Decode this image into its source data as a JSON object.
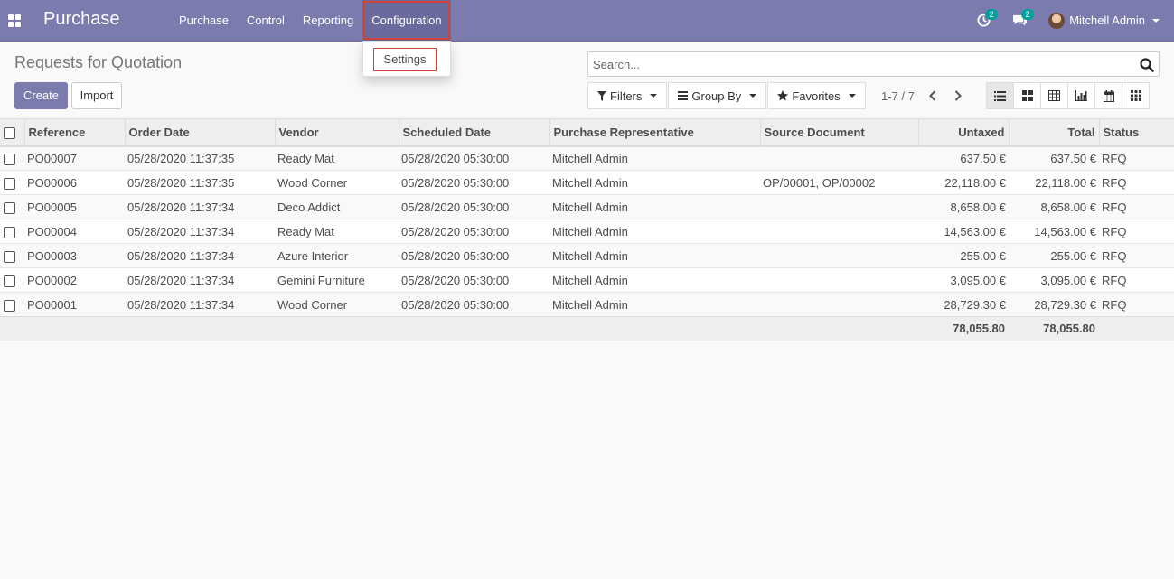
{
  "navbar": {
    "app_title": "Purchase",
    "menu": [
      "Purchase",
      "Control",
      "Reporting",
      "Configuration"
    ],
    "activities_badge": "2",
    "messages_badge": "2",
    "user_name": "Mitchell Admin"
  },
  "dropdown": {
    "settings_label": "Settings"
  },
  "control_panel": {
    "title": "Requests for Quotation",
    "create_label": "Create",
    "import_label": "Import",
    "search_placeholder": "Search...",
    "filters_label": "Filters",
    "group_by_label": "Group By",
    "favorites_label": "Favorites",
    "pager": "1-7 / 7"
  },
  "table": {
    "columns": [
      "Reference",
      "Order Date",
      "Vendor",
      "Scheduled Date",
      "Purchase Representative",
      "Source Document",
      "Untaxed",
      "Total",
      "Status"
    ],
    "rows": [
      [
        "PO00007",
        "05/28/2020 11:37:35",
        "Ready Mat",
        "05/28/2020 05:30:00",
        "Mitchell Admin",
        "",
        "637.50 €",
        "637.50 €",
        "RFQ"
      ],
      [
        "PO00006",
        "05/28/2020 11:37:35",
        "Wood Corner",
        "05/28/2020 05:30:00",
        "Mitchell Admin",
        "OP/00001, OP/00002",
        "22,118.00 €",
        "22,118.00 €",
        "RFQ"
      ],
      [
        "PO00005",
        "05/28/2020 11:37:34",
        "Deco Addict",
        "05/28/2020 05:30:00",
        "Mitchell Admin",
        "",
        "8,658.00 €",
        "8,658.00 €",
        "RFQ"
      ],
      [
        "PO00004",
        "05/28/2020 11:37:34",
        "Ready Mat",
        "05/28/2020 05:30:00",
        "Mitchell Admin",
        "",
        "14,563.00 €",
        "14,563.00 €",
        "RFQ"
      ],
      [
        "PO00003",
        "05/28/2020 11:37:34",
        "Azure Interior",
        "05/28/2020 05:30:00",
        "Mitchell Admin",
        "",
        "255.00 €",
        "255.00 €",
        "RFQ"
      ],
      [
        "PO00002",
        "05/28/2020 11:37:34",
        "Gemini Furniture",
        "05/28/2020 05:30:00",
        "Mitchell Admin",
        "",
        "3,095.00 €",
        "3,095.00 €",
        "RFQ"
      ],
      [
        "PO00001",
        "05/28/2020 11:37:34",
        "Wood Corner",
        "05/28/2020 05:30:00",
        "Mitchell Admin",
        "",
        "28,729.30 €",
        "28,729.30 €",
        "RFQ"
      ]
    ],
    "totals": {
      "untaxed": "78,055.80",
      "total": "78,055.80"
    }
  },
  "colors": {
    "brand": "#7c7bad",
    "highlight": "#d04437",
    "badge": "#00a09d"
  }
}
